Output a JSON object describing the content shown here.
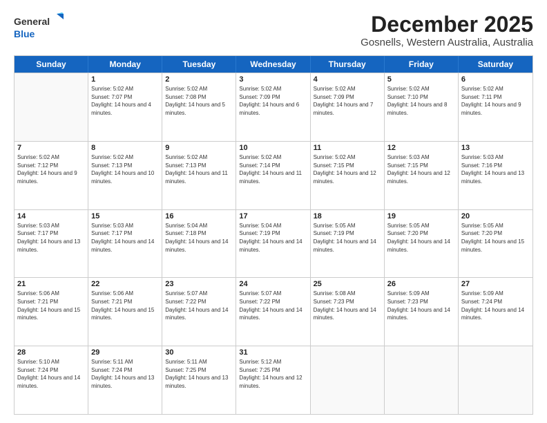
{
  "logo": {
    "general": "General",
    "blue": "Blue"
  },
  "title": "December 2025",
  "subtitle": "Gosnells, Western Australia, Australia",
  "calendar": {
    "headers": [
      "Sunday",
      "Monday",
      "Tuesday",
      "Wednesday",
      "Thursday",
      "Friday",
      "Saturday"
    ],
    "rows": [
      [
        {
          "day": "",
          "sunrise": "",
          "sunset": "",
          "daylight": ""
        },
        {
          "day": "1",
          "sunrise": "Sunrise: 5:02 AM",
          "sunset": "Sunset: 7:07 PM",
          "daylight": "Daylight: 14 hours and 4 minutes."
        },
        {
          "day": "2",
          "sunrise": "Sunrise: 5:02 AM",
          "sunset": "Sunset: 7:08 PM",
          "daylight": "Daylight: 14 hours and 5 minutes."
        },
        {
          "day": "3",
          "sunrise": "Sunrise: 5:02 AM",
          "sunset": "Sunset: 7:09 PM",
          "daylight": "Daylight: 14 hours and 6 minutes."
        },
        {
          "day": "4",
          "sunrise": "Sunrise: 5:02 AM",
          "sunset": "Sunset: 7:09 PM",
          "daylight": "Daylight: 14 hours and 7 minutes."
        },
        {
          "day": "5",
          "sunrise": "Sunrise: 5:02 AM",
          "sunset": "Sunset: 7:10 PM",
          "daylight": "Daylight: 14 hours and 8 minutes."
        },
        {
          "day": "6",
          "sunrise": "Sunrise: 5:02 AM",
          "sunset": "Sunset: 7:11 PM",
          "daylight": "Daylight: 14 hours and 9 minutes."
        }
      ],
      [
        {
          "day": "7",
          "sunrise": "Sunrise: 5:02 AM",
          "sunset": "Sunset: 7:12 PM",
          "daylight": "Daylight: 14 hours and 9 minutes."
        },
        {
          "day": "8",
          "sunrise": "Sunrise: 5:02 AM",
          "sunset": "Sunset: 7:13 PM",
          "daylight": "Daylight: 14 hours and 10 minutes."
        },
        {
          "day": "9",
          "sunrise": "Sunrise: 5:02 AM",
          "sunset": "Sunset: 7:13 PM",
          "daylight": "Daylight: 14 hours and 11 minutes."
        },
        {
          "day": "10",
          "sunrise": "Sunrise: 5:02 AM",
          "sunset": "Sunset: 7:14 PM",
          "daylight": "Daylight: 14 hours and 11 minutes."
        },
        {
          "day": "11",
          "sunrise": "Sunrise: 5:02 AM",
          "sunset": "Sunset: 7:15 PM",
          "daylight": "Daylight: 14 hours and 12 minutes."
        },
        {
          "day": "12",
          "sunrise": "Sunrise: 5:03 AM",
          "sunset": "Sunset: 7:15 PM",
          "daylight": "Daylight: 14 hours and 12 minutes."
        },
        {
          "day": "13",
          "sunrise": "Sunrise: 5:03 AM",
          "sunset": "Sunset: 7:16 PM",
          "daylight": "Daylight: 14 hours and 13 minutes."
        }
      ],
      [
        {
          "day": "14",
          "sunrise": "Sunrise: 5:03 AM",
          "sunset": "Sunset: 7:17 PM",
          "daylight": "Daylight: 14 hours and 13 minutes."
        },
        {
          "day": "15",
          "sunrise": "Sunrise: 5:03 AM",
          "sunset": "Sunset: 7:17 PM",
          "daylight": "Daylight: 14 hours and 14 minutes."
        },
        {
          "day": "16",
          "sunrise": "Sunrise: 5:04 AM",
          "sunset": "Sunset: 7:18 PM",
          "daylight": "Daylight: 14 hours and 14 minutes."
        },
        {
          "day": "17",
          "sunrise": "Sunrise: 5:04 AM",
          "sunset": "Sunset: 7:19 PM",
          "daylight": "Daylight: 14 hours and 14 minutes."
        },
        {
          "day": "18",
          "sunrise": "Sunrise: 5:05 AM",
          "sunset": "Sunset: 7:19 PM",
          "daylight": "Daylight: 14 hours and 14 minutes."
        },
        {
          "day": "19",
          "sunrise": "Sunrise: 5:05 AM",
          "sunset": "Sunset: 7:20 PM",
          "daylight": "Daylight: 14 hours and 14 minutes."
        },
        {
          "day": "20",
          "sunrise": "Sunrise: 5:05 AM",
          "sunset": "Sunset: 7:20 PM",
          "daylight": "Daylight: 14 hours and 15 minutes."
        }
      ],
      [
        {
          "day": "21",
          "sunrise": "Sunrise: 5:06 AM",
          "sunset": "Sunset: 7:21 PM",
          "daylight": "Daylight: 14 hours and 15 minutes."
        },
        {
          "day": "22",
          "sunrise": "Sunrise: 5:06 AM",
          "sunset": "Sunset: 7:21 PM",
          "daylight": "Daylight: 14 hours and 15 minutes."
        },
        {
          "day": "23",
          "sunrise": "Sunrise: 5:07 AM",
          "sunset": "Sunset: 7:22 PM",
          "daylight": "Daylight: 14 hours and 14 minutes."
        },
        {
          "day": "24",
          "sunrise": "Sunrise: 5:07 AM",
          "sunset": "Sunset: 7:22 PM",
          "daylight": "Daylight: 14 hours and 14 minutes."
        },
        {
          "day": "25",
          "sunrise": "Sunrise: 5:08 AM",
          "sunset": "Sunset: 7:23 PM",
          "daylight": "Daylight: 14 hours and 14 minutes."
        },
        {
          "day": "26",
          "sunrise": "Sunrise: 5:09 AM",
          "sunset": "Sunset: 7:23 PM",
          "daylight": "Daylight: 14 hours and 14 minutes."
        },
        {
          "day": "27",
          "sunrise": "Sunrise: 5:09 AM",
          "sunset": "Sunset: 7:24 PM",
          "daylight": "Daylight: 14 hours and 14 minutes."
        }
      ],
      [
        {
          "day": "28",
          "sunrise": "Sunrise: 5:10 AM",
          "sunset": "Sunset: 7:24 PM",
          "daylight": "Daylight: 14 hours and 14 minutes."
        },
        {
          "day": "29",
          "sunrise": "Sunrise: 5:11 AM",
          "sunset": "Sunset: 7:24 PM",
          "daylight": "Daylight: 14 hours and 13 minutes."
        },
        {
          "day": "30",
          "sunrise": "Sunrise: 5:11 AM",
          "sunset": "Sunset: 7:25 PM",
          "daylight": "Daylight: 14 hours and 13 minutes."
        },
        {
          "day": "31",
          "sunrise": "Sunrise: 5:12 AM",
          "sunset": "Sunset: 7:25 PM",
          "daylight": "Daylight: 14 hours and 12 minutes."
        },
        {
          "day": "",
          "sunrise": "",
          "sunset": "",
          "daylight": ""
        },
        {
          "day": "",
          "sunrise": "",
          "sunset": "",
          "daylight": ""
        },
        {
          "day": "",
          "sunrise": "",
          "sunset": "",
          "daylight": ""
        }
      ]
    ]
  }
}
